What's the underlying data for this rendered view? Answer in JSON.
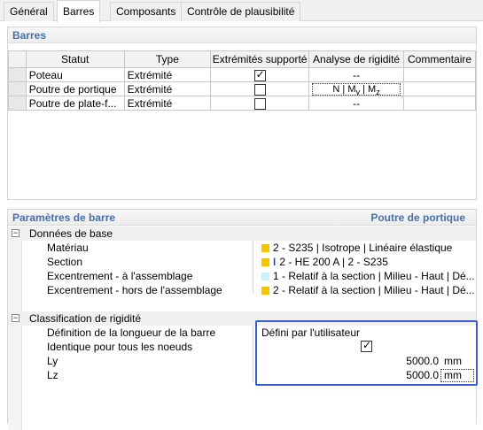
{
  "tabs": [
    {
      "label": "Général"
    },
    {
      "label": "Barres"
    },
    {
      "label": "Composants"
    },
    {
      "label": "Contrôle de plausibilité"
    }
  ],
  "barres": {
    "title": "Barres",
    "columns": [
      "Statut",
      "Type",
      "Extrémités supporté",
      "Analyse de rigidité",
      "Commentaire"
    ],
    "rows": [
      {
        "statut": "Poteau",
        "type": "Extrémité",
        "checked": true,
        "analyse": "--",
        "commentaire": ""
      },
      {
        "statut": "Poutre de portique",
        "type": "Extrémité",
        "checked": false,
        "analyse": "N | My | Mz",
        "commentaire": ""
      },
      {
        "statut": "Poutre de plate-f...",
        "type": "Extrémité",
        "checked": false,
        "analyse": "--",
        "commentaire": ""
      }
    ],
    "analyse_button": {
      "n": "N",
      "sep": " | ",
      "my": "M",
      "my_sub": "y",
      "mz": "M",
      "mz_sub": "z"
    }
  },
  "params": {
    "title": "Paramètres de barre",
    "context": "Poutre de portique",
    "groups": {
      "base": {
        "label": "Données de base",
        "toggle": "−",
        "rows": [
          {
            "label": "Matériau",
            "value": "2 - S235 | Isotrope | Linéaire élastique",
            "swatch": "#f2c500"
          },
          {
            "label": "Section",
            "value": "2 - HE 200 A | 2 - S235",
            "swatch": "#f2c500",
            "icon": "I"
          },
          {
            "label": "Excentrement - à l'assemblage",
            "value": "1 - Relatif à la section | Milieu - Haut | Dé...",
            "swatch": "#c9f1f7"
          },
          {
            "label": "Excentrement - hors de l'assemblage",
            "value": "2 - Relatif à la section | Milieu - Haut | Dé...",
            "swatch": "#f2c500"
          }
        ]
      },
      "rigidite": {
        "label": "Classification de rigidité",
        "toggle": "−",
        "rows": [
          {
            "label": "Définition de la longueur de la barre",
            "value": "Défini par l'utilisateur"
          },
          {
            "label": "Identique pour tous les noeuds",
            "checked": true
          },
          {
            "label": "Ly",
            "value": "5000.0",
            "unit": "mm"
          },
          {
            "label": "Lz",
            "value": "5000.0",
            "unit": "mm"
          }
        ]
      }
    }
  },
  "colors": {
    "accent": "#4a6fa5",
    "highlight": "#3d5bd6",
    "yellow": "#f2c500",
    "cyan": "#c9f1f7"
  }
}
